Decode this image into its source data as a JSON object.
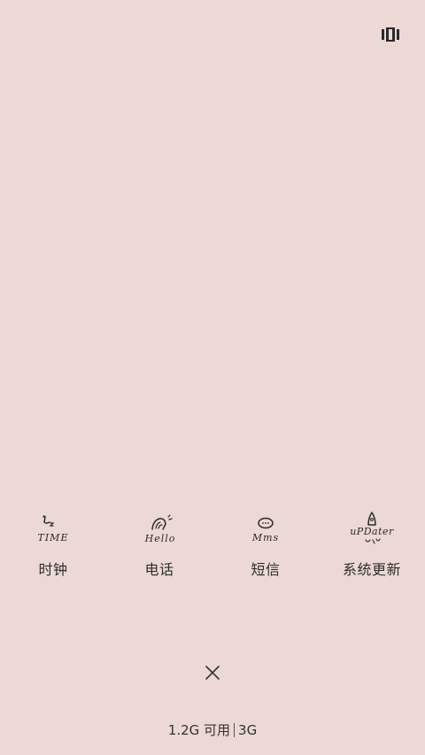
{
  "colors": {
    "background": "#ecd8d4",
    "text": "#2e2e2e",
    "icon_stroke": "#2a2a2a"
  },
  "header": {
    "recents_toggle_icon": "recents-view-icon"
  },
  "apps": [
    {
      "label": "时钟",
      "icon": "clock-time-icon",
      "icon_text": "TIME"
    },
    {
      "label": "电话",
      "icon": "phone-hello-icon",
      "icon_text": "Hello"
    },
    {
      "label": "短信",
      "icon": "sms-bubble-icon",
      "icon_text": "Mms"
    },
    {
      "label": "系统更新",
      "icon": "updater-rocket-icon",
      "icon_text": "uPDater"
    }
  ],
  "close_all": {
    "icon": "close-icon"
  },
  "memory": {
    "available": "1.2G 可用",
    "total": "3G"
  }
}
